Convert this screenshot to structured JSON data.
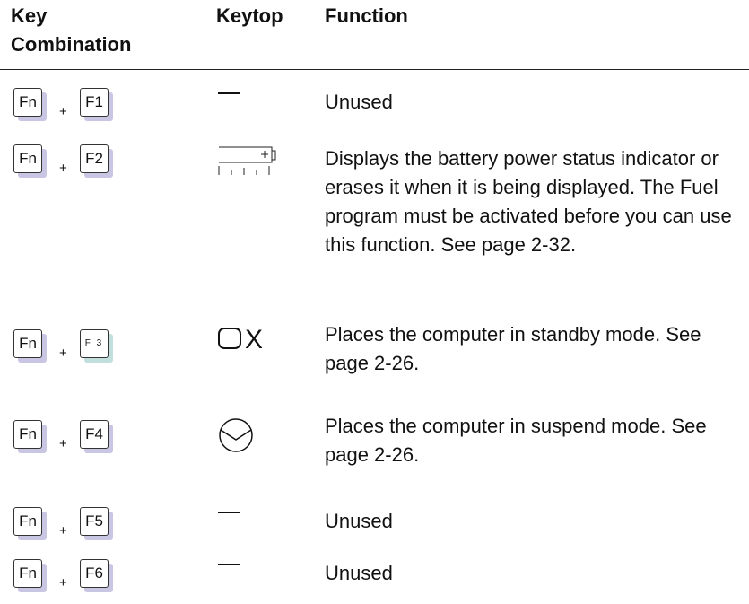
{
  "header": {
    "key_combination": "Key\nCombination",
    "keytop": "Keytop",
    "function": "Function"
  },
  "rows": [
    {
      "fn": "Fn",
      "plus": "+",
      "fkey": "F1",
      "keytop_icon": "dash-icon",
      "function": "Unused"
    },
    {
      "fn": "Fn",
      "plus": "+",
      "fkey": "F2",
      "keytop_icon": "battery-status-icon",
      "function": "Displays the battery power status indicator or erases it when it is being displayed.  The Fuel program must be activated before you can use this function.  See page 2-32."
    },
    {
      "fn": "Fn",
      "plus": "+",
      "fkey": "F 3",
      "keytop_icon": "standby-icon",
      "keytop_text": "X",
      "function": "Places the computer in standby mode.  See  page 2-26."
    },
    {
      "fn": "Fn",
      "plus": "+",
      "fkey": "F4",
      "keytop_icon": "suspend-moon-icon",
      "function": "Places the computer in suspend mode.  See page 2-26."
    },
    {
      "fn": "Fn",
      "plus": "+",
      "fkey": "F5",
      "keytop_icon": "dash-icon",
      "function": "Unused"
    },
    {
      "fn": "Fn",
      "plus": "+",
      "fkey": "F6",
      "keytop_icon": "dash-icon",
      "function": "Unused"
    }
  ]
}
